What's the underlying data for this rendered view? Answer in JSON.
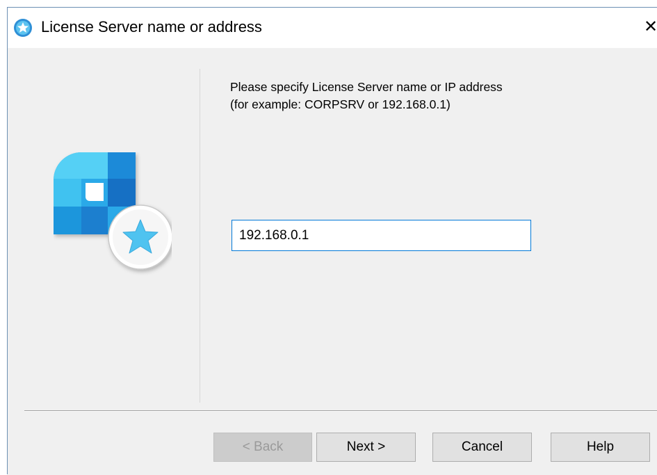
{
  "window": {
    "title": "License Server name or address",
    "close_label": "✕"
  },
  "main": {
    "instruction_line1": "Please specify License Server name or IP address",
    "instruction_line2": "(for example: CORPSRV or 192.168.0.1)",
    "server_input_value": "192.168.0.1"
  },
  "buttons": {
    "back": "< Back",
    "next": "Next >",
    "cancel": "Cancel",
    "help": "Help"
  },
  "colors": {
    "accent": "#0078d7",
    "logo_light": "#4fc3f7",
    "logo_dark": "#1976d2"
  },
  "icons": {
    "title_icon": "license-server-star-icon",
    "logo": "license-server-logo"
  }
}
